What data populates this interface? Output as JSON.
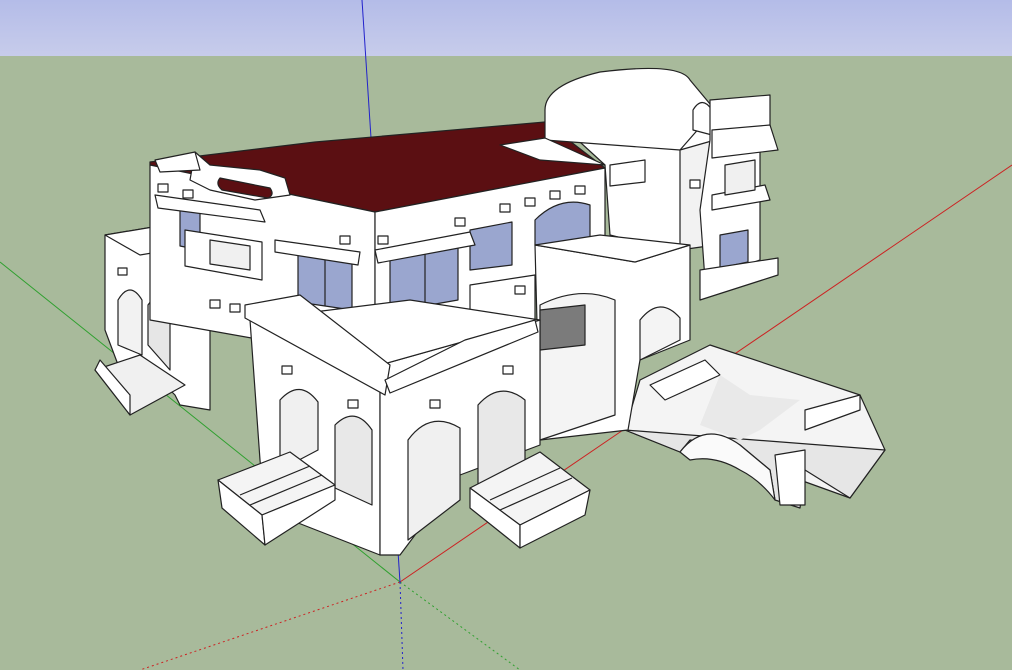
{
  "viewport": {
    "sky_top_color": "#b4bce8",
    "sky_bottom_color": "#c7cceb",
    "ground_color": "#a8ba9b",
    "wall_color": "#ffffff",
    "edge_color": "#222222",
    "roof_color": "#5b0f12",
    "glass_color": "#9aa6cf",
    "shadow_color": "#d2d2d2",
    "axes": [
      {
        "name": "red-axis",
        "color": "#cc2222"
      },
      {
        "name": "green-axis",
        "color": "#2fa02f"
      },
      {
        "name": "blue-axis",
        "color": "#2222cc"
      }
    ]
  }
}
